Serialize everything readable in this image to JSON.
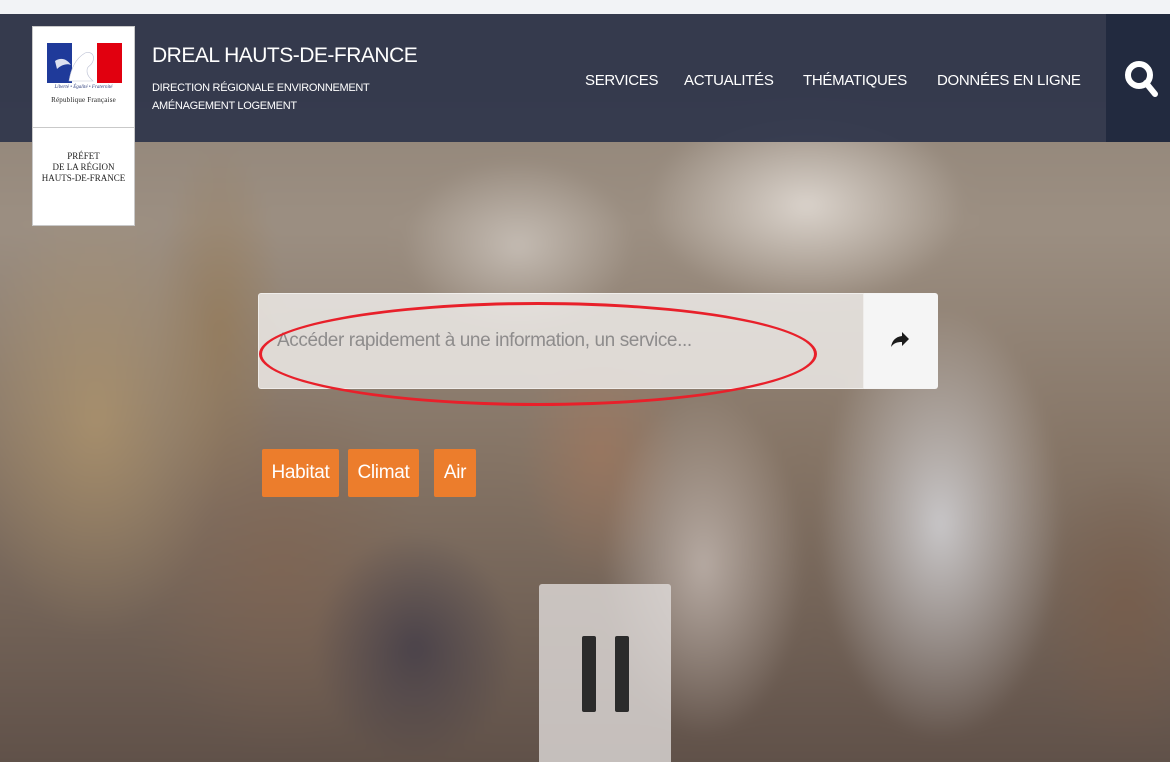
{
  "brand": {
    "motto": "Liberté • Égalité • Fraternité",
    "republique": "République Française",
    "prefet_lines": [
      "PRÉFET",
      "DE LA RÉGION",
      "HAUTS-DE-FRANCE"
    ],
    "flag_colors": [
      "#1f3a9a",
      "#ffffff",
      "#e1000f"
    ]
  },
  "header": {
    "title": "DREAL HAUTS-DE-FRANCE",
    "subtitle_lines": [
      "DIRECTION RÉGIONALE ENVIRONNEMENT",
      "AMÉNAGEMENT LOGEMENT"
    ],
    "background": "#2e344a"
  },
  "nav": {
    "items": [
      {
        "label": "SERVICES"
      },
      {
        "label": "ACTUALITÉS"
      },
      {
        "label": "THÉMATIQUES"
      },
      {
        "label": "DONNÉES EN LIGNE"
      }
    ],
    "search_icon": "search-icon"
  },
  "quick_search": {
    "placeholder": "Accéder rapidement à une information, un service...",
    "value": "",
    "submit_icon": "share-arrow-icon",
    "annotation_color": "#e8202a"
  },
  "tags": [
    {
      "label": "Habitat"
    },
    {
      "label": "Climat"
    },
    {
      "label": "Air"
    }
  ],
  "tag_color": "#ec7d2c",
  "slideshow": {
    "control_icon": "pause-icon"
  }
}
